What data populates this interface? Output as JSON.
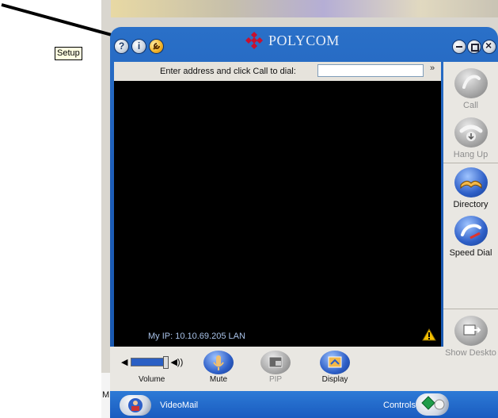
{
  "app": {
    "brand": "POLYCOM"
  },
  "titlebar": {
    "help_glyph": "?",
    "info_glyph": "i",
    "tooltip": "Setup"
  },
  "dial": {
    "label": "Enter address and click Call to dial:",
    "value": "",
    "more": "»"
  },
  "video": {
    "ip": "My IP: 10.10.69.205 LAN"
  },
  "right_panel": {
    "call": "Call",
    "hang_up": "Hang Up",
    "directory": "Directory",
    "speed_dial": "Speed Dial",
    "show_desktop": "Show Deskto"
  },
  "controls": {
    "volume": "Volume",
    "mute": "Mute",
    "pip": "PIP",
    "display": "Display"
  },
  "bottom": {
    "videomail": "VideoMail",
    "controls": "Controls"
  },
  "desktop": {
    "left_text": [
      "M"
    ]
  },
  "colors": {
    "window_blue": "#1d5db8",
    "panel": "#e9e7e2",
    "accent_red": "#c8102e"
  }
}
